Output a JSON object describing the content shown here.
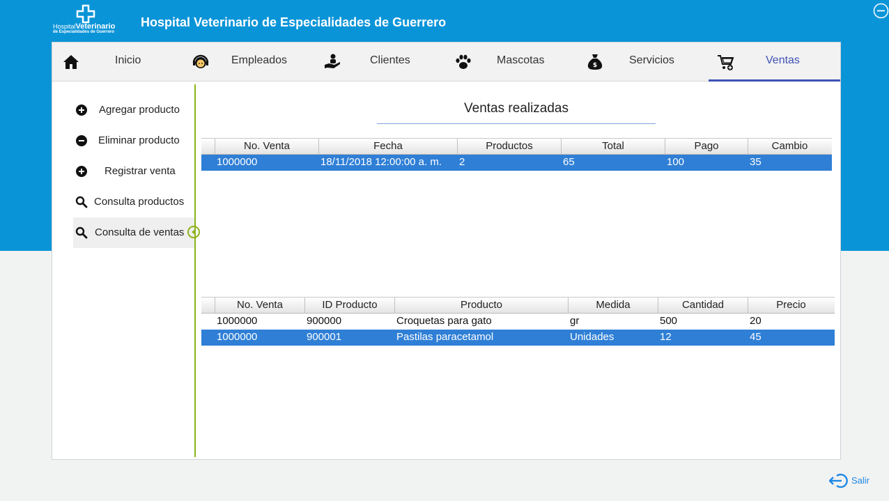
{
  "header": {
    "logo_line1_a": "Hospital",
    "logo_line1_b": "Veterinario",
    "logo_line2": "de Especialidades de Guerrero",
    "title": "Hospital Veterinario de Especialidades de Guerrero"
  },
  "nav": {
    "tabs": [
      {
        "label": "Inicio",
        "icon": "home-icon"
      },
      {
        "label": "Empleados",
        "icon": "headset-person-icon"
      },
      {
        "label": "Clientes",
        "icon": "client-hand-icon"
      },
      {
        "label": "Mascotas",
        "icon": "paw-icon"
      },
      {
        "label": "Servicios",
        "icon": "money-bag-icon"
      },
      {
        "label": "Ventas",
        "icon": "cart-add-icon"
      }
    ],
    "active": "Ventas"
  },
  "sidebar": {
    "items": [
      {
        "label": "Agregar producto",
        "icon": "plus-circle-icon"
      },
      {
        "label": "Eliminar producto",
        "icon": "minus-circle-icon"
      },
      {
        "label": "Registrar venta",
        "icon": "plus-circle-icon"
      },
      {
        "label": "Consulta productos",
        "icon": "search-icon"
      },
      {
        "label": "Consulta de ventas",
        "icon": "search-icon"
      }
    ],
    "selected": "Consulta de ventas"
  },
  "main": {
    "title": "Ventas realizadas",
    "sales_table": {
      "columns": [
        "No. Venta",
        "Fecha",
        "Productos",
        "Total",
        "Pago",
        "Cambio"
      ],
      "rows": [
        [
          "1000000",
          "18/11/2018 12:00:00 a. m.",
          "2",
          "65",
          "100",
          "35"
        ]
      ],
      "selected_row": 0
    },
    "detail_table": {
      "columns": [
        "No. Venta",
        "ID Producto",
        "Producto",
        "Medida",
        "Cantidad",
        "Precio"
      ],
      "rows": [
        [
          "1000000",
          "900000",
          "Croquetas para gato",
          "gr",
          "500",
          "20"
        ],
        [
          "1000000",
          "900001",
          "Pastilas paracetamol",
          "Unidades",
          "12",
          "45"
        ]
      ],
      "selected_row": 1
    }
  },
  "footer": {
    "exit_label": "Salir"
  },
  "colors": {
    "banner": "#0a94d8",
    "accent": "#3f51b5",
    "selection": "#2f7fd6",
    "divider": "#8bb21a"
  }
}
